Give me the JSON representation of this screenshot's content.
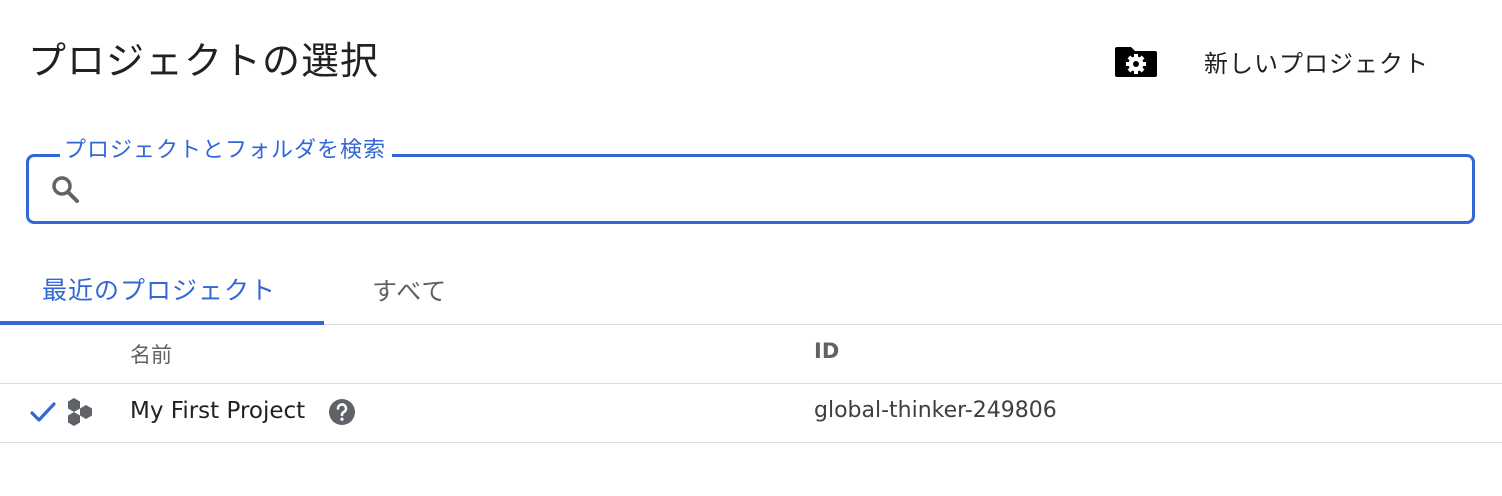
{
  "dialog": {
    "title": "プロジェクトの選択",
    "new_project_label": "新しいプロジェクト",
    "new_project_icon": "folder-settings-icon"
  },
  "search": {
    "label": "プロジェクトとフォルダを検索",
    "value": "",
    "placeholder": "",
    "icon": "search-icon"
  },
  "tabs": [
    {
      "label": "最近のプロジェクト",
      "active": true
    },
    {
      "label": "すべて",
      "active": false
    }
  ],
  "table": {
    "columns": {
      "name": "名前",
      "id": "ID"
    },
    "rows": [
      {
        "selected": true,
        "name": "My First Project",
        "id": "global-thinker-249806",
        "icons": [
          "check-icon",
          "project-type-icon",
          "help-icon"
        ]
      }
    ]
  },
  "colors": {
    "accent": "#3367d6",
    "text_primary": "#202124",
    "text_secondary": "#5f6368",
    "divider": "#dadce0",
    "icon": "#5f6368"
  }
}
